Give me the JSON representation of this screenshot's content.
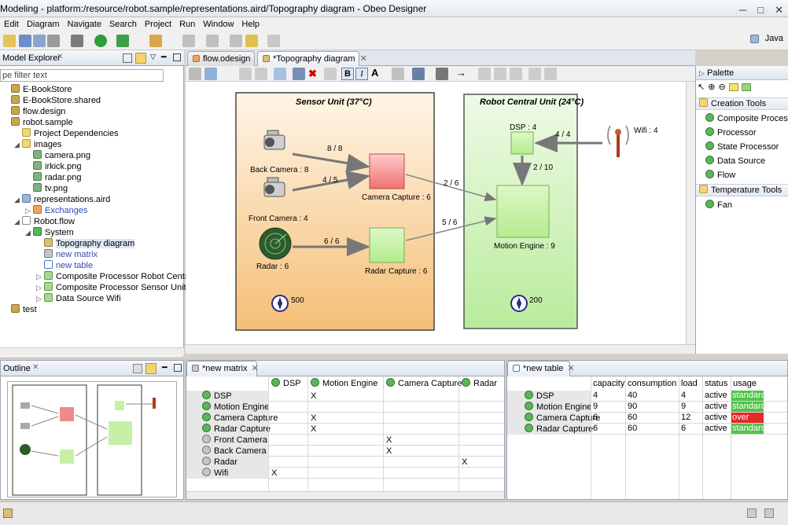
{
  "window": {
    "title": "Modeling - platform:/resource/robot.sample/representations.aird/Topography diagram - Obeo Designer",
    "controls": [
      "─",
      "□",
      "✕"
    ]
  },
  "menu": [
    "Edit",
    "Diagram",
    "Navigate",
    "Search",
    "Project",
    "Run",
    "Window",
    "Help"
  ],
  "perspective": "Java",
  "model_explorer": {
    "tab": "Model Explorer",
    "filter_placeholder": "pe filter text",
    "items": [
      {
        "label": "E-BookStore",
        "icon": "f-proj",
        "indent": 0,
        "tw": ""
      },
      {
        "label": "E-BookStore.shared",
        "icon": "f-proj",
        "indent": 0,
        "tw": ""
      },
      {
        "label": "flow.design",
        "icon": "f-proj",
        "indent": 0,
        "tw": ""
      },
      {
        "label": "robot.sample",
        "icon": "f-proj",
        "indent": 0,
        "tw": ""
      },
      {
        "label": "Project Dependencies",
        "icon": "f-folder",
        "indent": 1,
        "tw": ""
      },
      {
        "label": "images",
        "icon": "f-folder",
        "indent": 1,
        "tw": "◢"
      },
      {
        "label": "camera.png",
        "icon": "f-img",
        "indent": 2,
        "tw": ""
      },
      {
        "label": "irkick.png",
        "icon": "f-img",
        "indent": 2,
        "tw": ""
      },
      {
        "label": "radar.png",
        "icon": "f-img",
        "indent": 2,
        "tw": ""
      },
      {
        "label": "tv.png",
        "icon": "f-img",
        "indent": 2,
        "tw": ""
      },
      {
        "label": "representations.aird",
        "icon": "f-aird",
        "indent": 1,
        "tw": "◢"
      },
      {
        "label": "Exchanges",
        "icon": "f-x",
        "indent": 2,
        "tw": "▷",
        "link": true
      },
      {
        "label": "Robot.flow",
        "icon": "f-file",
        "indent": 1,
        "tw": "◢"
      },
      {
        "label": "System",
        "icon": "f-flow",
        "indent": 2,
        "tw": "◢"
      },
      {
        "label": "Topography diagram",
        "icon": "f-diag",
        "indent": 3,
        "tw": "",
        "selected": true
      },
      {
        "label": "new matrix",
        "icon": "f-mat",
        "indent": 3,
        "tw": "",
        "link": true
      },
      {
        "label": "new table",
        "icon": "f-tab",
        "indent": 3,
        "tw": "",
        "link": true
      },
      {
        "label": "Composite Processor Robot Central Unit",
        "icon": "f-comp",
        "indent": 3,
        "tw": "▷"
      },
      {
        "label": "Composite Processor Sensor Unit",
        "icon": "f-comp",
        "indent": 3,
        "tw": "▷"
      },
      {
        "label": "Data Source Wifi",
        "icon": "f-comp",
        "indent": 3,
        "tw": "▷"
      },
      {
        "label": "test",
        "icon": "f-proj",
        "indent": 0,
        "tw": ""
      }
    ]
  },
  "editor_tabs": [
    {
      "label": "flow.odesign",
      "active": false
    },
    {
      "label": "*Topography diagram",
      "active": true
    }
  ],
  "diagram": {
    "sensor_unit": {
      "title": "Sensor Unit (37°C)",
      "fan": "500"
    },
    "robot_unit": {
      "title": "Robot Central Unit (24°C)",
      "fan": "200"
    },
    "nodes": {
      "back_camera": "Back Camera : 8",
      "front_camera": "Front Camera : 4",
      "radar": "Radar : 6",
      "camera_capture": "Camera Capture : 6",
      "radar_capture": "Radar Capture : 6",
      "dsp": "DSP : 4",
      "motion_engine": "Motion Engine : 9",
      "wifi": "Wifi : 4"
    },
    "edges": {
      "back_cam": "8 / 8",
      "front_cam": "4 / 5",
      "radar": "6 / 6",
      "cam_capture": "2 / 6",
      "radar_capture": "5 / 6",
      "wifi": "4 / 4",
      "dsp": "2 / 10"
    }
  },
  "palette": {
    "title": "Palette",
    "groups": [
      {
        "title": "Creation Tools",
        "items": [
          "Composite Processor",
          "Processor",
          "State Processor",
          "Data Source",
          "Flow"
        ]
      },
      {
        "title": "Temperature Tools",
        "items": [
          "Fan"
        ]
      }
    ]
  },
  "outline": {
    "tab": "Outline"
  },
  "matrix": {
    "tab": "*new matrix",
    "columns": [
      "DSP",
      "Motion Engine",
      "Camera Capture",
      "Radar"
    ],
    "rows": [
      {
        "label": "DSP",
        "marks": [
          "",
          "X",
          "",
          ""
        ]
      },
      {
        "label": "Motion Engine",
        "marks": [
          "",
          "",
          "",
          ""
        ]
      },
      {
        "label": "Camera Capture",
        "marks": [
          "",
          "X",
          "",
          ""
        ]
      },
      {
        "label": "Radar Capture",
        "marks": [
          "",
          "X",
          "",
          ""
        ]
      },
      {
        "label": "Front Camera",
        "marks": [
          "",
          "",
          "X",
          ""
        ]
      },
      {
        "label": "Back Camera",
        "marks": [
          "",
          "",
          "X",
          ""
        ]
      },
      {
        "label": "Radar",
        "marks": [
          "",
          "",
          "",
          "X"
        ]
      },
      {
        "label": "Wifi",
        "marks": [
          "X",
          "",
          "",
          ""
        ]
      }
    ]
  },
  "table": {
    "tab": "*new table",
    "columns": [
      "capacity",
      "consumption",
      "load",
      "status",
      "usage"
    ],
    "rows": [
      {
        "label": "DSP",
        "values": [
          "4",
          "40",
          "4",
          "active",
          "standard"
        ],
        "usage_color": "#4fc44a"
      },
      {
        "label": "Motion Engine",
        "values": [
          "9",
          "90",
          "9",
          "active",
          "standard"
        ],
        "usage_color": "#4fc44a"
      },
      {
        "label": "Camera Capture",
        "values": [
          "6",
          "60",
          "12",
          "active",
          "over"
        ],
        "usage_color": "#e52a2a"
      },
      {
        "label": "Radar Capture",
        "values": [
          "6",
          "60",
          "6",
          "active",
          "standard"
        ],
        "usage_color": "#4fc44a"
      }
    ]
  },
  "colors": {
    "sensor_fill_top": "#fff3e3",
    "sensor_fill_bottom": "#f5c27e",
    "robot_fill": "#c9f0b4",
    "capture_red": "#f08a8a",
    "node_green": "#c6f0a6",
    "accent": "#3347b8"
  }
}
